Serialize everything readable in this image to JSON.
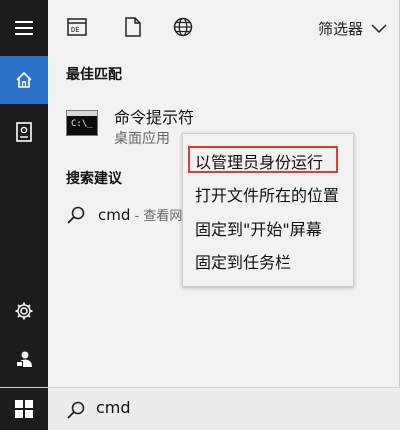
{
  "top_bar": {
    "filter_label": "筛选器"
  },
  "sections": {
    "best_match": "最佳匹配",
    "search_suggestions": "搜索建议"
  },
  "best_match_item": {
    "name": "命令提示符",
    "type": "桌面应用",
    "icon_text": "C:\\_"
  },
  "suggestion": {
    "query": "cmd",
    "hint": " - 查看网"
  },
  "context_menu": {
    "items": [
      "以管理员身份运行",
      "打开文件所在的位置",
      "固定到\"开始\"屏幕",
      "固定到任务栏"
    ],
    "highlighted_index": 0,
    "highlight_color": "#e53935"
  },
  "taskbar": {
    "search_value": "cmd"
  },
  "colors": {
    "rail": "#1c1c1c",
    "active_rail": "#2b72c8",
    "panel": "#f2f2f2"
  },
  "icons": [
    "hamburger-menu-icon",
    "home-icon",
    "document-icon",
    "settings-gear-icon",
    "people-icon",
    "windows-logo-icon",
    "apps-icon",
    "file-icon",
    "globe-icon",
    "chevron-down-icon",
    "search-icon"
  ]
}
